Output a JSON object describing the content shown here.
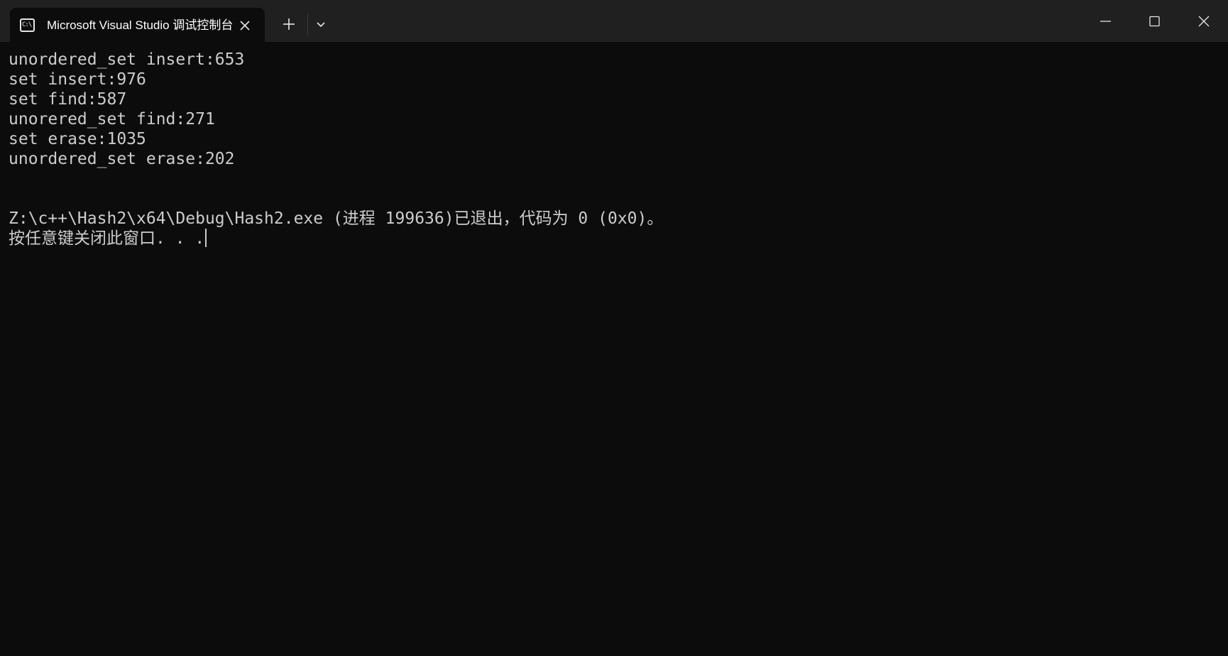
{
  "window": {
    "tab_icon_text": "C:\\",
    "tab_title": "Microsoft Visual Studio 调试控制台",
    "icons": {
      "tab_icon": "console-icon",
      "tab_close": "close-icon",
      "new_tab": "plus-icon",
      "dropdown": "chevron-down-icon",
      "minimize": "minimize-icon",
      "maximize": "maximize-icon",
      "close": "close-icon"
    }
  },
  "console": {
    "lines": [
      "unordered_set insert:653",
      "set insert:976",
      "set find:587",
      "unorered_set find:271",
      "set erase:1035",
      "unordered_set erase:202",
      "",
      "",
      "Z:\\c++\\Hash2\\x64\\Debug\\Hash2.exe (进程 199636)已退出，代码为 0 (0x0)。",
      "按任意键关闭此窗口. . ."
    ],
    "colors": {
      "background": "#0c0c0c",
      "text": "#cccccc",
      "titlebar": "#202020"
    }
  }
}
